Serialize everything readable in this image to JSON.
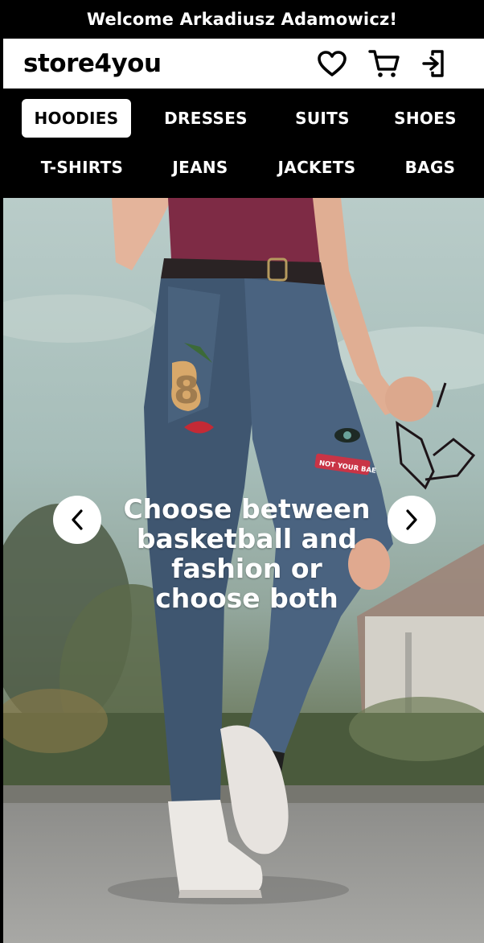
{
  "welcome": {
    "text": "Welcome Arkadiusz Adamowicz!"
  },
  "header": {
    "logo": "store4you",
    "icons": [
      "heart-icon",
      "cart-icon",
      "logout-icon"
    ]
  },
  "nav": {
    "items": [
      {
        "label": "HOODIES",
        "active": true
      },
      {
        "label": "DRESSES"
      },
      {
        "label": "SUITS"
      },
      {
        "label": "SHOES"
      },
      {
        "label": "T-SHIRTS"
      },
      {
        "label": "JEANS"
      },
      {
        "label": "JACKETS"
      },
      {
        "label": "BAGS"
      }
    ]
  },
  "hero": {
    "headline": "Choose between basketball and fashion or choose both",
    "patch_text": "NOT YOUR BAE",
    "prev_icon": "chevron-left-icon",
    "next_icon": "chevron-right-icon"
  }
}
